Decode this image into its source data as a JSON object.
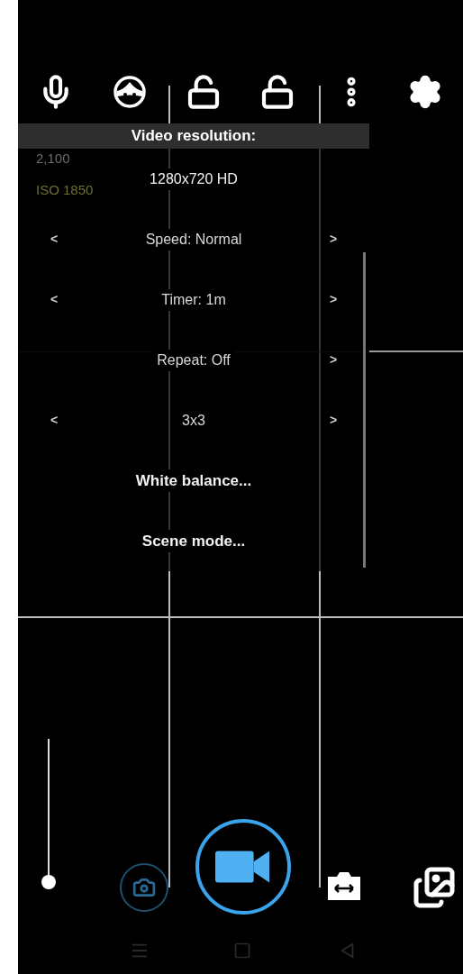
{
  "overlay_info": [
    "2,100",
    "ISO 1850"
  ],
  "menu": {
    "title": "Video resolution:",
    "items": [
      {
        "kind": "value",
        "label": "1280x720 HD"
      },
      {
        "kind": "stepper",
        "label": "Speed: Normal",
        "prev": "<",
        "next": ">"
      },
      {
        "kind": "stepper",
        "label": "Timer: 1m",
        "prev": "<",
        "next": ">"
      },
      {
        "kind": "stepper",
        "label": "Repeat: Off",
        "next": ">"
      },
      {
        "kind": "stepper",
        "label": "3x3",
        "prev": "<",
        "next": ">"
      },
      {
        "kind": "action",
        "label": "White balance..."
      },
      {
        "kind": "action",
        "label": "Scene mode..."
      }
    ]
  },
  "zoom_slider": {
    "level": 0
  }
}
